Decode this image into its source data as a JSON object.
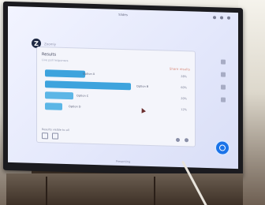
{
  "window": {
    "title": "Slides"
  },
  "app": {
    "logo_letter": "Z",
    "logo_text": "Zoomly"
  },
  "card": {
    "title": "Results",
    "subtitle": "Live poll responses",
    "action_label": "Share results"
  },
  "rows": [
    {
      "label": "Option A",
      "value": "28%",
      "fill": 0.28
    },
    {
      "label": "Option B",
      "value": "60%",
      "fill": 0.6
    },
    {
      "label": "Option C",
      "value": "20%",
      "fill": 0.2
    },
    {
      "label": "Option D",
      "value": "12%",
      "fill": 0.12
    }
  ],
  "footer": {
    "label": "Results visible to all",
    "bottom_label": "Presenting"
  },
  "colors": {
    "bar": "#3da3dd",
    "accent": "#1a73e8"
  },
  "icons": {
    "window_controls": [
      "minimize-icon",
      "maximize-icon",
      "close-icon"
    ],
    "fab": "record-icon",
    "sidebar": [
      "chat-icon",
      "people-icon",
      "settings-icon",
      "more-icon"
    ],
    "footer": [
      "grid-icon",
      "copy-icon"
    ],
    "pager": [
      "prev-icon",
      "next-icon"
    ]
  }
}
